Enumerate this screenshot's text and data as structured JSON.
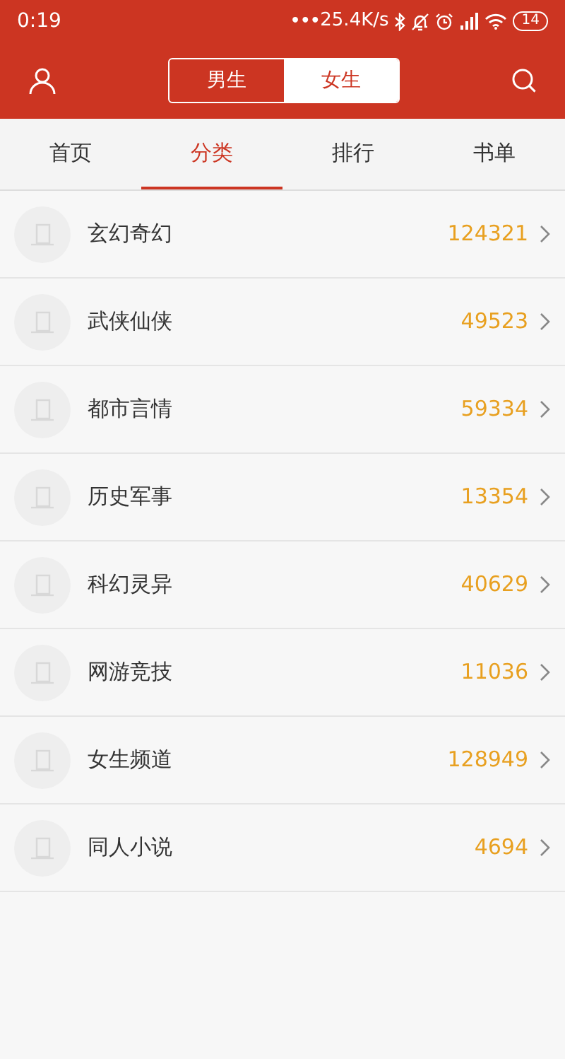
{
  "status_bar": {
    "time": "0:19",
    "dots": "•••",
    "speed": "25.4K/s",
    "battery": "14"
  },
  "header": {
    "segments": [
      {
        "label": "男生",
        "selected": false
      },
      {
        "label": "女生",
        "selected": true
      }
    ]
  },
  "tabs": [
    {
      "label": "首页",
      "selected": false
    },
    {
      "label": "分类",
      "selected": true
    },
    {
      "label": "排行",
      "selected": false
    },
    {
      "label": "书单",
      "selected": false
    }
  ],
  "categories": [
    {
      "name": "玄幻奇幻",
      "count": "124321"
    },
    {
      "name": "武侠仙侠",
      "count": "49523"
    },
    {
      "name": "都市言情",
      "count": "59334"
    },
    {
      "name": "历史军事",
      "count": "13354"
    },
    {
      "name": "科幻灵异",
      "count": "40629"
    },
    {
      "name": "网游竞技",
      "count": "11036"
    },
    {
      "name": "女生频道",
      "count": "128949"
    },
    {
      "name": "同人小说",
      "count": "4694"
    }
  ]
}
